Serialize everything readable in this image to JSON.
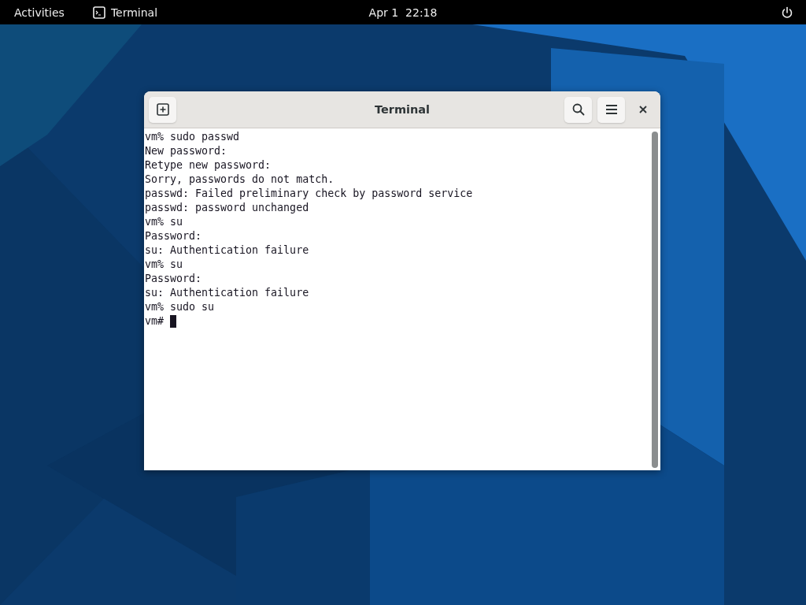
{
  "top_bar": {
    "activities": "Activities",
    "app_name": "Terminal",
    "clock": "Apr 1  22:18"
  },
  "window": {
    "title": "Terminal"
  },
  "terminal": {
    "lines": [
      {
        "text": "vm% sudo passwd",
        "cursor": false
      },
      {
        "text": "New password:",
        "cursor": false
      },
      {
        "text": "Retype new password:",
        "cursor": false
      },
      {
        "text": "Sorry, passwords do not match.",
        "cursor": false
      },
      {
        "text": "passwd: Failed preliminary check by password service",
        "cursor": false
      },
      {
        "text": "passwd: password unchanged",
        "cursor": false
      },
      {
        "text": "vm% su",
        "cursor": false
      },
      {
        "text": "Password:",
        "cursor": false
      },
      {
        "text": "su: Authentication failure",
        "cursor": false
      },
      {
        "text": "vm% su",
        "cursor": false
      },
      {
        "text": "Password:",
        "cursor": false
      },
      {
        "text": "su: Authentication failure",
        "cursor": false
      },
      {
        "text": "vm% sudo su",
        "cursor": false
      },
      {
        "text": "vm#",
        "cursor": true
      }
    ]
  }
}
